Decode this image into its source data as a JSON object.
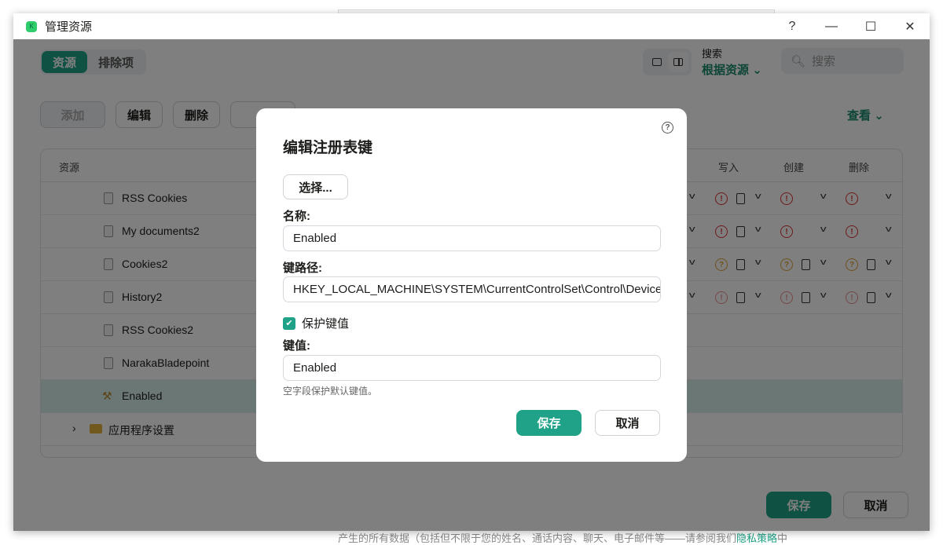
{
  "window": {
    "title": "管理资源",
    "help": "?",
    "minimize": "—",
    "maximize": "☐",
    "close": "✕"
  },
  "tabs": [
    {
      "label": "资源",
      "active": true
    },
    {
      "label": "排除项",
      "active": false
    }
  ],
  "search": {
    "by_label": "搜索",
    "by_value": "根据资源",
    "placeholder": "搜索"
  },
  "toolbar": {
    "add": "添加",
    "edit": "编辑",
    "delete": "删除",
    "more": "…"
  },
  "view_label": "查看",
  "table": {
    "headers": {
      "resource": "资源",
      "write": "写入",
      "create": "创建",
      "delete": "删除"
    },
    "rows": [
      {
        "name": "RSS Cookies",
        "status": "deny"
      },
      {
        "name": "My documents2",
        "status": "deny"
      },
      {
        "name": "Cookies2",
        "status": "unknown"
      },
      {
        "name": "History2",
        "status": "deny-faded"
      },
      {
        "name": "RSS Cookies2",
        "status": ""
      },
      {
        "name": "NarakaBladepoint",
        "status": ""
      },
      {
        "name": "Enabled",
        "status": "",
        "selected": true
      }
    ],
    "folder": "应用程序设置"
  },
  "main_buttons": {
    "save": "保存",
    "cancel": "取消"
  },
  "dialog": {
    "title": "编辑注册表键",
    "help": "?",
    "select_button": "选择...",
    "name_label": "名称:",
    "name_value": "Enabled",
    "path_label": "键路径:",
    "path_value": "HKEY_LOCAL_MACHINE\\SYSTEM\\CurrentControlSet\\Control\\DeviceGuard",
    "protect_label": "保护键值",
    "protect_checked": true,
    "value_label": "键值:",
    "value_value": "Enabled",
    "hint": "空字段保护默认键值。",
    "save": "保存",
    "cancel": "取消"
  },
  "footer": {
    "text": "产生的所有数据（包括但不限于您的姓名、通话内容、聊天、电子邮件等——请参阅我们",
    "link": "隐私策略",
    "suffix": "中"
  },
  "colors": {
    "accent": "#1fa287",
    "deny": "#dd3333",
    "unknown": "#e0a33a"
  }
}
